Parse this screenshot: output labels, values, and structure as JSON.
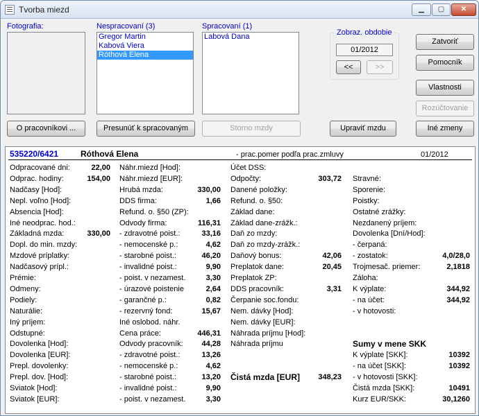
{
  "window": {
    "title": "Tvorba miezd"
  },
  "labels": {
    "fotografia": "Fotografia:",
    "nespracovani": "Nespracovaní (3)",
    "spracovani": "Spracovaní (1)",
    "obdobie": "Zobraz. obdobie"
  },
  "nespracovani_list": [
    "Gregor Martin",
    "Kabová Viera",
    "Róthová Elena"
  ],
  "spracovani_list": [
    "Labová Dana"
  ],
  "period": {
    "value": "01/2012",
    "prev": "<<",
    "next": ">>"
  },
  "buttons": {
    "o_pracovnikovi": "O pracovníkovi ...",
    "presunut": "Presunúť k spracovaným",
    "storno": "Storno mzdy",
    "upravit": "Upraviť mzdu",
    "zatvorit": "Zatvoriť",
    "pomocnik": "Pomocník",
    "vlastnosti": "Vlastnosti",
    "rozuctovanie": "Rozúčtovanie",
    "ine_zmeny": "Iné zmeny"
  },
  "detail": {
    "id": "535220/6421",
    "name": "Róthová Elena",
    "note": "- prac.pomer podľa prac.zmluvy",
    "period": "01/2012",
    "col1": [
      {
        "label": "Odpracované dni:",
        "value": "22,00"
      },
      {
        "label": "Odprac. hodiny:",
        "value": "154,00"
      },
      {
        "label": "Nadčasy [Hod]:",
        "value": ""
      },
      {
        "label": "Nepl. voľno [Hod]:",
        "value": ""
      },
      {
        "label": "Absencia [Hod]:",
        "value": ""
      },
      {
        "label": "Iné neodprac. hod.:",
        "value": ""
      },
      {
        "label": "Základná mzda:",
        "value": "330,00"
      },
      {
        "label": "Dopl. do min. mzdy:",
        "value": ""
      },
      {
        "label": "Mzdové príplatky:",
        "value": ""
      },
      {
        "label": "Nadčasový prípl.:",
        "value": ""
      },
      {
        "label": "Prémie:",
        "value": ""
      },
      {
        "label": "Odmeny:",
        "value": ""
      },
      {
        "label": "Podiely:",
        "value": ""
      },
      {
        "label": "Naturálie:",
        "value": ""
      },
      {
        "label": "Iný príjem:",
        "value": ""
      },
      {
        "label": "Odstupné:",
        "value": ""
      },
      {
        "label": "Dovolenka [Hod]:",
        "value": ""
      },
      {
        "label": "Dovolenka [EUR]:",
        "value": ""
      },
      {
        "label": "Prepl. dovolenky:",
        "value": ""
      },
      {
        "label": "Prepl. dov. [Hod]:",
        "value": ""
      },
      {
        "label": "Sviatok [Hod]:",
        "value": ""
      },
      {
        "label": "Sviatok [EUR]:",
        "value": ""
      }
    ],
    "col2": [
      {
        "label": "Náhr.miezd [Hod]:",
        "value": ""
      },
      {
        "label": "Náhr.miezd [EUR]:",
        "value": ""
      },
      {
        "label": "Hrubá mzda:",
        "value": "330,00"
      },
      {
        "label": "DDS firma:",
        "value": "1,66"
      },
      {
        "label": "Refund. o. §50 (ZP):",
        "value": ""
      },
      {
        "label": "Odvody firma:",
        "value": "116,31"
      },
      {
        "label": " - zdravotné poist.:",
        "value": "33,16"
      },
      {
        "label": " - nemocenské p.:",
        "value": "4,62"
      },
      {
        "label": " - starobné poist.:",
        "value": "46,20"
      },
      {
        "label": " - invalidné poist.:",
        "value": "9,90"
      },
      {
        "label": " - poist. v nezamest.",
        "value": "3,30"
      },
      {
        "label": " - úrazové poistenie",
        "value": "2,64"
      },
      {
        "label": " - garančné p.:",
        "value": "0,82"
      },
      {
        "label": " - rezervný fond:",
        "value": "15,67"
      },
      {
        "label": "Iné oslobod. náhr.",
        "value": ""
      },
      {
        "label": "Cena práce:",
        "value": "446,31"
      },
      {
        "label": "Odvody pracovník:",
        "value": "44,28"
      },
      {
        "label": " - zdravotné poist.:",
        "value": "13,26"
      },
      {
        "label": " - nemocenské p.:",
        "value": "4,62"
      },
      {
        "label": " - starobné poist.:",
        "value": "13,20"
      },
      {
        "label": " - invalidné poist.:",
        "value": "9,90"
      },
      {
        "label": " - poist. v nezamest.",
        "value": "3,30"
      }
    ],
    "col3": [
      {
        "label": "Účet DSS:",
        "value": ""
      },
      {
        "label": "Odpočty:",
        "value": "303,72"
      },
      {
        "label": "Danené položky:",
        "value": ""
      },
      {
        "label": "Refund. o. §50:",
        "value": ""
      },
      {
        "label": "Základ dane:",
        "value": ""
      },
      {
        "label": "Základ dane-zrážk.:",
        "value": ""
      },
      {
        "label": "Daň zo mzdy:",
        "value": ""
      },
      {
        "label": "Daň zo mzdy-zrážk.:",
        "value": ""
      },
      {
        "label": "Daňový bonus:",
        "value": "42,06"
      },
      {
        "label": "Preplatok dane:",
        "value": "20,45"
      },
      {
        "label": "Preplatok ZP:",
        "value": ""
      },
      {
        "label": "DDS pracovník:",
        "value": "3,31"
      },
      {
        "label": "Čerpanie soc.fondu:",
        "value": ""
      },
      {
        "label": "Nem. dávky [Hod]:",
        "value": ""
      },
      {
        "label": "Nem. dávky [EUR]:",
        "value": ""
      },
      {
        "label": "Náhrada príjmu [Hod]:",
        "value": ""
      },
      {
        "label": "Náhrada príjmu",
        "value": ""
      }
    ],
    "cista_mzda": {
      "label": "Čistá mzda [EUR]",
      "value": "348,23"
    },
    "col4": [
      {
        "label": "Stravné:",
        "value": ""
      },
      {
        "label": "Sporenie:",
        "value": ""
      },
      {
        "label": "Poistky:",
        "value": ""
      },
      {
        "label": "Ostatné zrážky:",
        "value": ""
      },
      {
        "label": "Nezdanený príjem:",
        "value": ""
      },
      {
        "label": "Dovolenka [Dní/Hod]:",
        "value": ""
      },
      {
        "label": "  - čerpaná:",
        "value": ""
      },
      {
        "label": "  - zostatok:",
        "value": "4,0/28,0"
      },
      {
        "label": "Trojmesač. priemer:",
        "value": "2,1818"
      },
      {
        "label": "Záloha:",
        "value": ""
      },
      {
        "label": "K výplate:",
        "value": "344,92"
      },
      {
        "label": " - na účet:",
        "value": "344,92"
      },
      {
        "label": " - v hotovosti:",
        "value": ""
      }
    ],
    "skk_title": "Sumy v mene SKK",
    "skk": [
      {
        "label": "K výplate [SKK]:",
        "value": "10392"
      },
      {
        "label": " - na účet [SKK]:",
        "value": "10392"
      },
      {
        "label": " - v hotovosti [SKK]:",
        "value": ""
      },
      {
        "label": "Čistá mzda [SKK]:",
        "value": "10491"
      },
      {
        "label": "Kurz EUR/SKK:",
        "value": "30,1260"
      }
    ]
  }
}
